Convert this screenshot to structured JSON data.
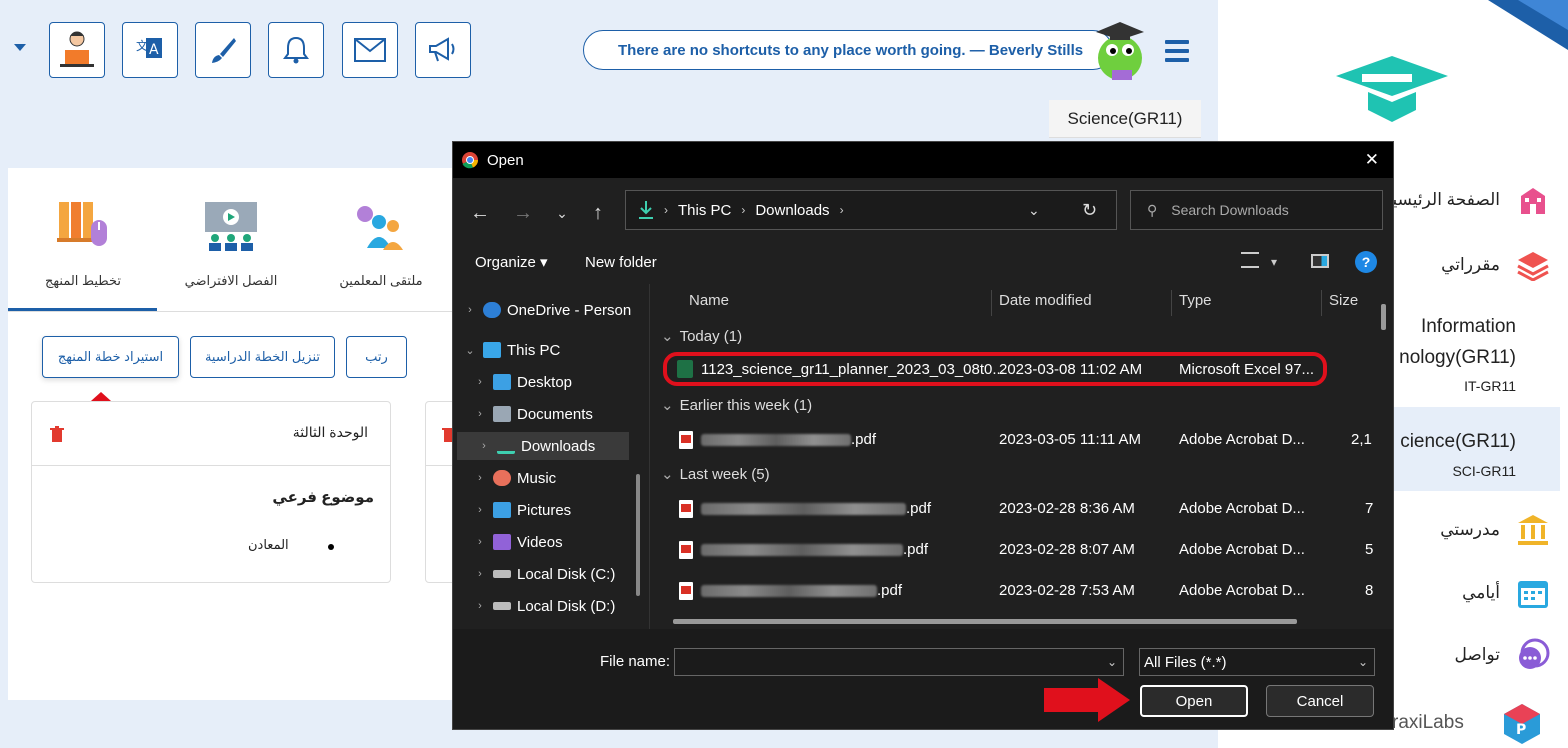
{
  "toolbar": {
    "dropdown_icon": "caret-down-icon",
    "buttons": [
      "teacher-icon",
      "translate-icon",
      "brush-icon",
      "bell-icon",
      "mail-icon",
      "megaphone-icon"
    ]
  },
  "quote": "There are no shortcuts to any place worth going. — Beverly Stills",
  "course_tag": "Science(GR11)",
  "sidebar": {
    "items": [
      {
        "label": "الصفحة الرئيسية",
        "icon": "school-building-icon"
      },
      {
        "label": "مقرراتي",
        "icon": "layers-icon"
      },
      {
        "label": "Information",
        "label2": "nology(GR11)",
        "code": "IT-GR11"
      },
      {
        "label": "cience(GR11)",
        "code": "SCI-GR11"
      },
      {
        "label": "مدرستي",
        "icon": "institution-icon"
      },
      {
        "label": "أيامي",
        "icon": "calendar-icon"
      },
      {
        "label": "تواصل",
        "icon": "chat-icon"
      }
    ],
    "brand": "raxiLabs"
  },
  "tabs": [
    "تخطيط المنهج",
    "الفصل الافتراضي",
    "ملتقى المعلمين"
  ],
  "plan_buttons": {
    "import": "استيراد خطة المنهج",
    "download": "تنزيل الخطة الدراسية",
    "sort": "رتب"
  },
  "unit": {
    "title": "الوحدة الثالثة",
    "subtopic": "موضوع فرعي",
    "item": "المعادن"
  },
  "dialog": {
    "title": "Open",
    "close": "✕",
    "address": [
      "This PC",
      "Downloads"
    ],
    "search_placeholder": "Search Downloads",
    "organize": "Organize",
    "new_folder": "New folder",
    "help": "?",
    "tree": [
      {
        "label": "OneDrive - Person"
      },
      {
        "label": "This PC"
      },
      {
        "label": "Desktop"
      },
      {
        "label": "Documents"
      },
      {
        "label": "Downloads"
      },
      {
        "label": "Music"
      },
      {
        "label": "Pictures"
      },
      {
        "label": "Videos"
      },
      {
        "label": "Local Disk (C:)"
      },
      {
        "label": "Local Disk (D:)"
      }
    ],
    "columns": {
      "name": "Name",
      "date": "Date modified",
      "type": "Type",
      "size": "Size"
    },
    "groups": {
      "today": "Today (1)",
      "earlier": "Earlier this week (1)",
      "last": "Last week (5)"
    },
    "files": [
      {
        "name": "1123_science_gr11_planner_2023_03_08t0...",
        "date": "2023-03-08 11:02 AM",
        "type": "Microsoft Excel 97...",
        "size": ""
      },
      {
        "name": ".pdf",
        "date": "2023-03-05 11:11 AM",
        "type": "Adobe Acrobat D...",
        "size": "2,1"
      },
      {
        "name": ".pdf",
        "date": "2023-02-28 8:36 AM",
        "type": "Adobe Acrobat D...",
        "size": "7"
      },
      {
        "name": ".pdf",
        "date": "2023-02-28 8:07 AM",
        "type": "Adobe Acrobat D...",
        "size": "5"
      },
      {
        "name": ".pdf",
        "date": "2023-02-28 7:53 AM",
        "type": "Adobe Acrobat D...",
        "size": "8"
      }
    ],
    "file_name_label": "File name:",
    "file_name_value": "",
    "filter": "All Files (*.*)",
    "open": "Open",
    "cancel": "Cancel"
  },
  "colors": {
    "brand_blue": "#1d5fa8",
    "highlight_red": "#e0101c",
    "teal": "#1fc3b2"
  }
}
